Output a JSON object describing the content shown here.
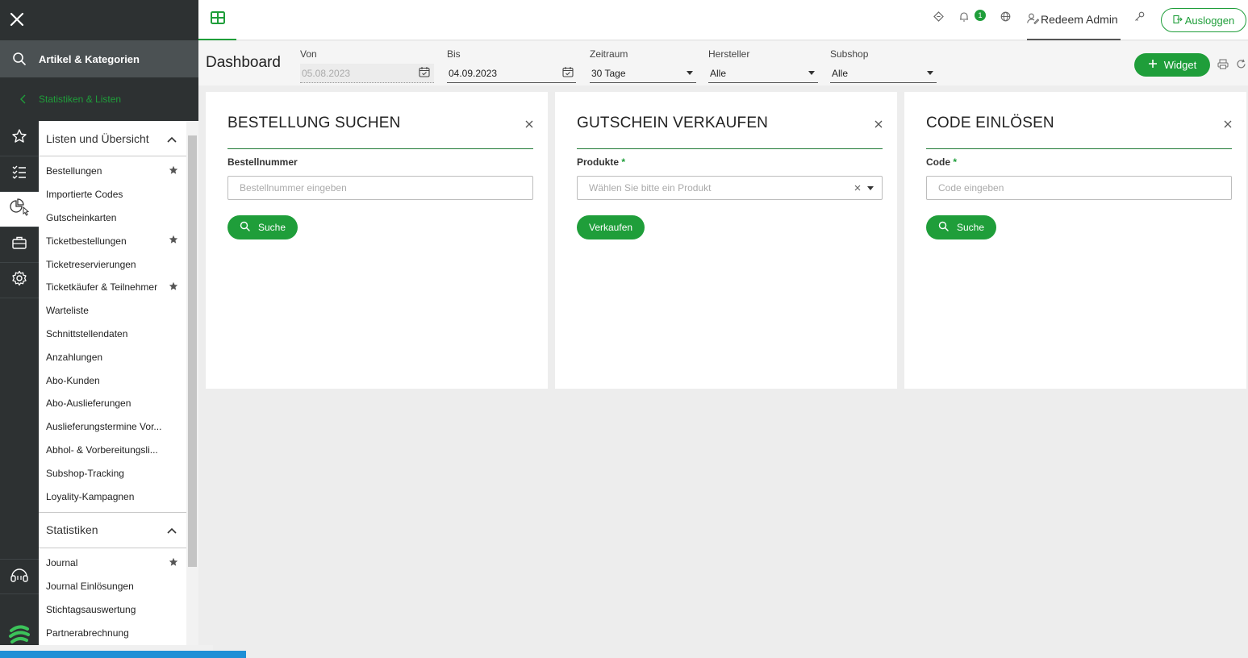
{
  "rail": {
    "search_label": "Artikel & Kategorien",
    "back_label": "Statistiken & Listen"
  },
  "menu": {
    "section1": "Listen und Übersicht",
    "items1": [
      {
        "label": "Bestellungen",
        "star": true
      },
      {
        "label": "Importierte Codes",
        "star": false
      },
      {
        "label": "Gutscheinkarten",
        "star": false
      },
      {
        "label": "Ticketbestellungen",
        "star": true
      },
      {
        "label": "Ticketreservierungen",
        "star": false
      },
      {
        "label": "Ticketkäufer & Teilnehmer",
        "star": true
      },
      {
        "label": "Warteliste",
        "star": false
      },
      {
        "label": "Schnittstellendaten",
        "star": false
      },
      {
        "label": "Anzahlungen",
        "star": false
      },
      {
        "label": "Abo-Kunden",
        "star": false
      },
      {
        "label": "Abo-Auslieferungen",
        "star": false
      },
      {
        "label": "Auslieferungstermine Vor...",
        "star": false
      },
      {
        "label": "Abhol- & Vorbereitungsli...",
        "star": false
      },
      {
        "label": "Subshop-Tracking",
        "star": false
      },
      {
        "label": "Loyality-Kampagnen",
        "star": false
      }
    ],
    "section2": "Statistiken",
    "items2": [
      {
        "label": "Journal",
        "star": true
      },
      {
        "label": "Journal Einlösungen",
        "star": false
      },
      {
        "label": "Stichtagsauswertung",
        "star": false
      },
      {
        "label": "Partnerabrechnung",
        "star": false
      }
    ]
  },
  "header": {
    "notification_count": "1",
    "user_name": "Redeem Admin",
    "logout_label": "Ausloggen"
  },
  "filters": {
    "title": "Dashboard",
    "von_label": "Von",
    "von_value": "05.08.2023",
    "bis_label": "Bis",
    "bis_value": "04.09.2023",
    "zeitraum_label": "Zeitraum",
    "zeitraum_value": "30 Tage",
    "hersteller_label": "Hersteller",
    "hersteller_value": "Alle",
    "subshop_label": "Subshop",
    "subshop_value": "Alle",
    "widget_label": "Widget"
  },
  "cards": [
    {
      "title": "BESTELLUNG SUCHEN",
      "field_label": "Bestellnummer",
      "required": "",
      "placeholder": "Bestellnummer eingeben",
      "button": "Suche"
    },
    {
      "title": "GUTSCHEIN VERKAUFEN",
      "field_label": "Produkte",
      "required": "*",
      "placeholder": "Wählen Sie bitte ein Produkt",
      "button": "Verkaufen"
    },
    {
      "title": "CODE EINLÖSEN",
      "field_label": "Code",
      "required": "*",
      "placeholder": "Code eingeben",
      "button": "Suche"
    }
  ],
  "colors": {
    "accent": "#1f9e3a",
    "rail": "#2d3132",
    "progress": "#1e8fd6"
  }
}
